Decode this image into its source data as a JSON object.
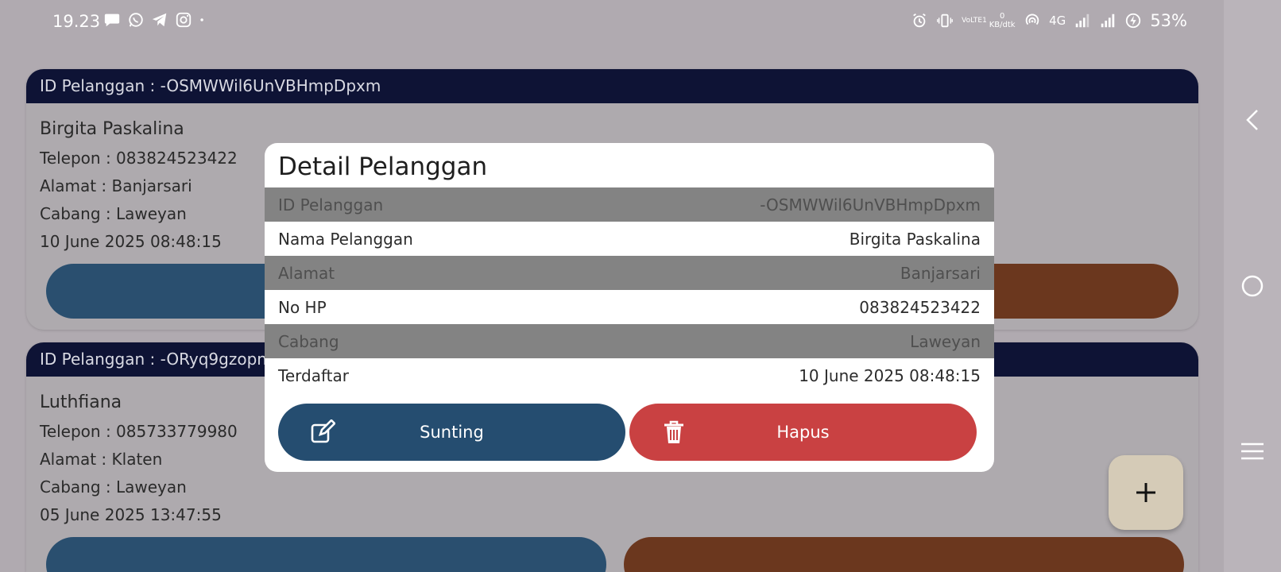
{
  "status_bar": {
    "time": "19.23",
    "left_icons": [
      "chat-bubble-icon",
      "whatsapp-icon",
      "telegram-icon",
      "instagram-icon",
      "dot-icon"
    ],
    "right_icons": [
      "alarm-icon",
      "vibrate-icon",
      "volte-icon",
      "data-speed-icon",
      "hotspot-icon",
      "4g-icon",
      "signal-icon",
      "signal-icon",
      "battery-charging-icon"
    ],
    "volte": "VoLTE1",
    "data_speed": "0\nKB/dtk",
    "network": "4G",
    "battery": "53%"
  },
  "cards": [
    {
      "header": "ID Pelanggan : -OSMWWil6UnVBHmpDpxm",
      "name": "Birgita Paskalina",
      "phone": "Telepon : 083824523422",
      "address": "Alamat : Banjarsari",
      "branch": "Cabang : Laweyan",
      "date": "10 June 2025 08:48:15",
      "btn_left_color": "#2a4f6f",
      "btn_right_color": "#6b371e"
    },
    {
      "header": "ID Pelanggan : -ORyq9gzopnC",
      "name": "Luthfiana",
      "phone": "Telepon : 085733779980",
      "address": "Alamat : Klaten",
      "branch": "Cabang : Laweyan",
      "date": "05 June 2025 13:47:55",
      "btn_left_color": "#2a4f6f",
      "btn_right_color": "#6b371e"
    }
  ],
  "modal": {
    "title": "Detail Pelanggan",
    "rows": [
      {
        "label": "ID Pelanggan",
        "value": "-OSMWWil6UnVBHmpDpxm"
      },
      {
        "label": "Nama Pelanggan",
        "value": "Birgita Paskalina"
      },
      {
        "label": "Alamat",
        "value": "Banjarsari"
      },
      {
        "label": "No HP",
        "value": "083824523422"
      },
      {
        "label": "Cabang",
        "value": "Laweyan"
      },
      {
        "label": "Terdaftar",
        "value": "10 June 2025 08:48:15"
      }
    ],
    "edit_label": "Sunting",
    "delete_label": "Hapus",
    "edit_icon": "edit-icon",
    "delete_icon": "trash-icon",
    "edit_color": "#254d70",
    "delete_color": "#c94142"
  },
  "fab": {
    "icon": "plus-icon"
  },
  "nav": {
    "icons": [
      "back-chevron-icon",
      "home-circle-icon",
      "recents-menu-icon"
    ]
  },
  "colors": {
    "header_bg": "#0e1335",
    "overlay_bg": "#b0aab0",
    "grey_row": "#838383",
    "fab_bg": "#d5cbb7"
  }
}
